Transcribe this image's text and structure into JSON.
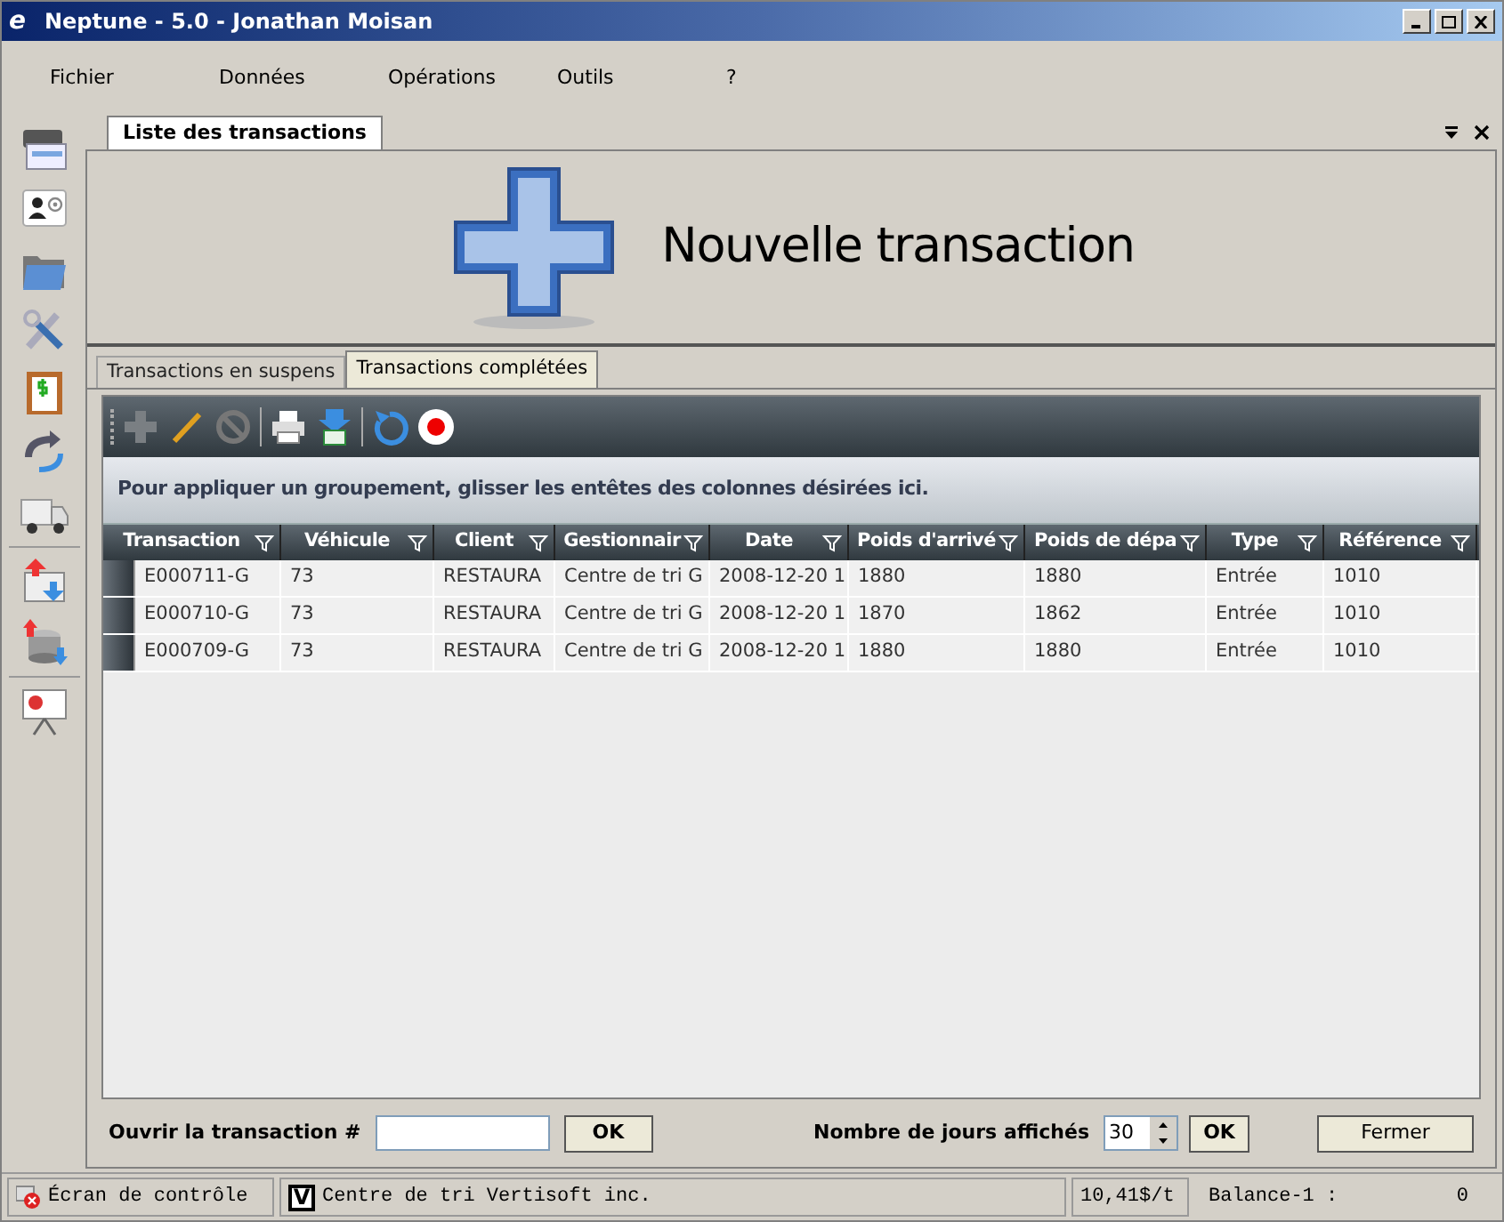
{
  "window": {
    "title": "Neptune - 5.0 - Jonathan Moisan",
    "icon_letter": "e"
  },
  "menu": [
    "Fichier",
    "Données",
    "Opérations",
    "Outils",
    "?"
  ],
  "document_tab": {
    "label": "Liste des transactions"
  },
  "banner": {
    "title": "Nouvelle transaction"
  },
  "tabs": [
    {
      "label": "Transactions en suspens",
      "selected": false
    },
    {
      "label": "Transactions complétées",
      "selected": true
    }
  ],
  "grid": {
    "group_hint": "Pour appliquer un groupement, glisser les entêtes des colonnes désirées ici.",
    "columns": [
      "Transaction",
      "Véhicule",
      "Client",
      "Gestionnair",
      "Date",
      "Poids d'arrivé",
      "Poids de dépa",
      "Type",
      "Référence"
    ],
    "rows": [
      {
        "cells": [
          "E000711-G",
          "73",
          "RESTAURA",
          "Centre de tri G",
          "2008-12-20 1",
          "1880",
          "1880",
          "Entrée",
          "1010"
        ]
      },
      {
        "cells": [
          "E000710-G",
          "73",
          "RESTAURA",
          "Centre de tri G",
          "2008-12-20 1",
          "1870",
          "1862",
          "Entrée",
          "1010"
        ]
      },
      {
        "cells": [
          "E000709-G",
          "73",
          "RESTAURA",
          "Centre de tri G",
          "2008-12-20 1",
          "1880",
          "1880",
          "Entrée",
          "1010"
        ]
      }
    ]
  },
  "open_transaction": {
    "label": "Ouvrir la transaction #",
    "button": "OK"
  },
  "days_shown": {
    "label": "Nombre de jours affichés",
    "value": "30",
    "button": "OK"
  },
  "close_button": "Fermer",
  "status_bar": {
    "screen": "Écran de contrôle",
    "site_badge": "V",
    "site": "Centre de tri Vertisoft inc.",
    "price": "10,41$/t",
    "scale_label": "Balance-1 :",
    "scale_value": "0"
  }
}
